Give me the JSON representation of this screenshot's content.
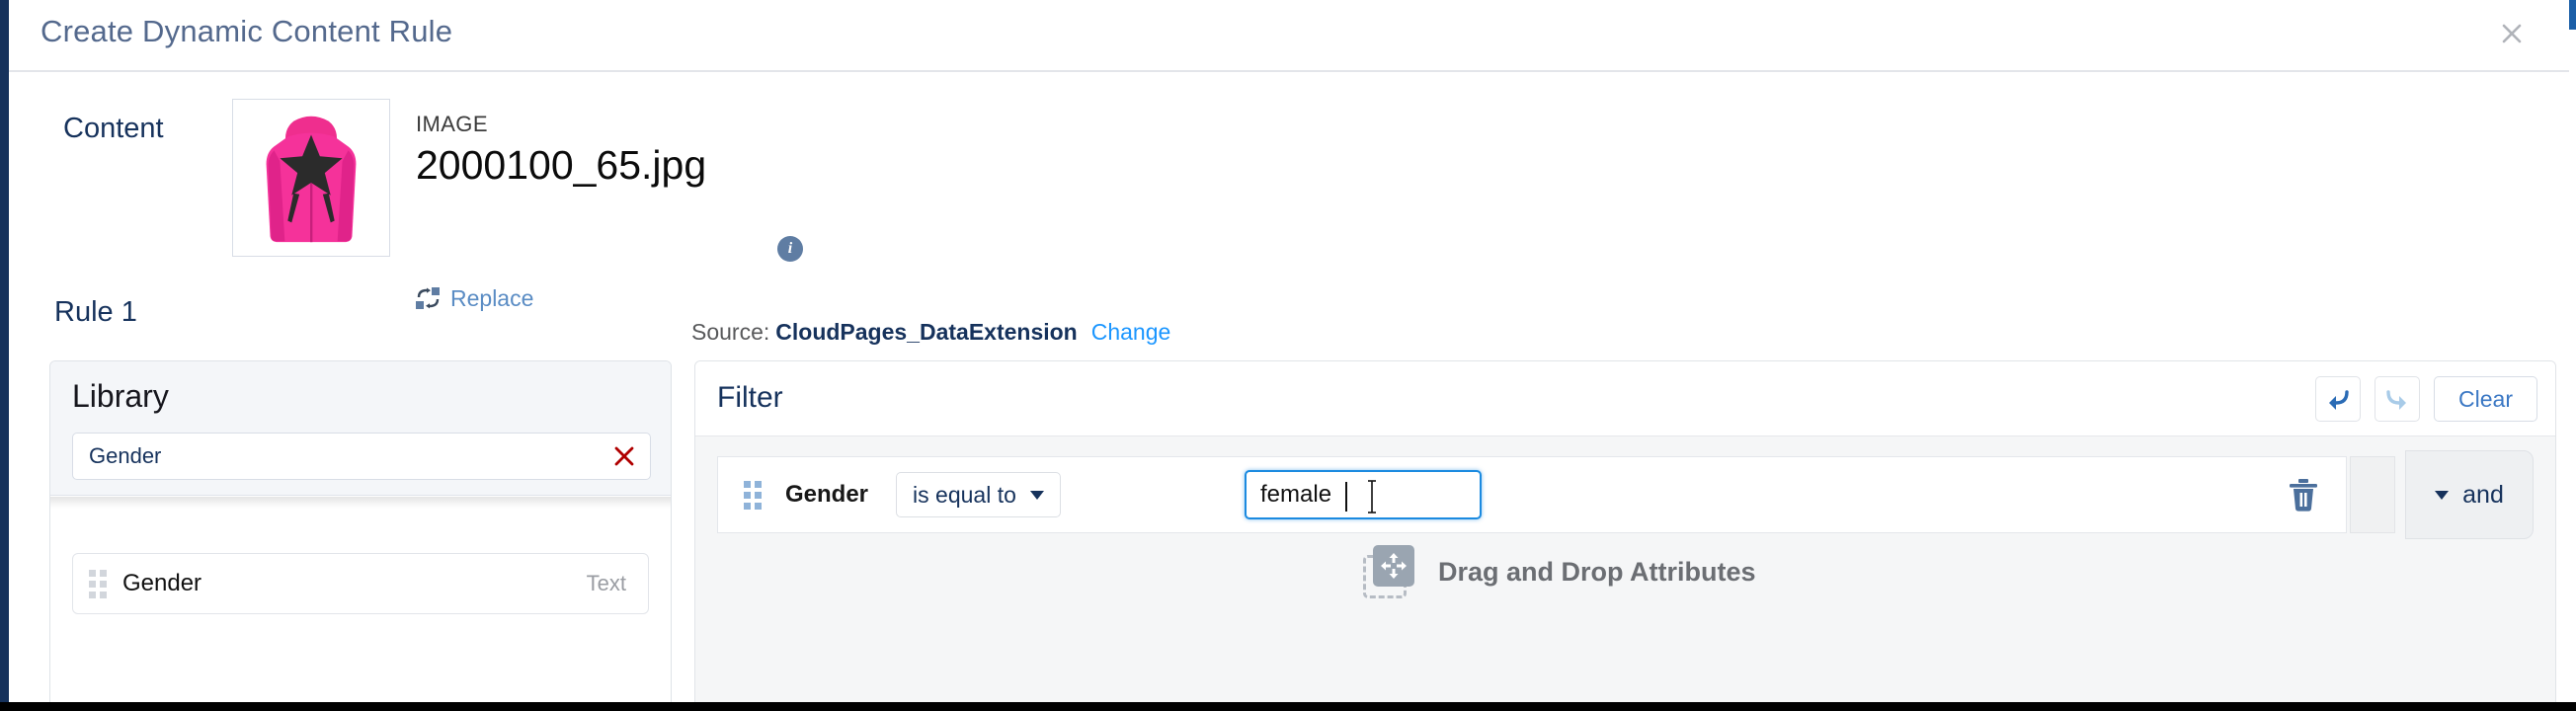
{
  "modal": {
    "title": "Create Dynamic Content Rule",
    "close_icon": "close-icon"
  },
  "content": {
    "label": "Content",
    "asset_kind": "IMAGE",
    "asset_name": "2000100_65.jpg",
    "info_badge": "i",
    "replace_label": "Replace",
    "thumbnail_alt": "pink hooded jacket with black star"
  },
  "rule": {
    "title": "Rule 1"
  },
  "source": {
    "label": "Source:",
    "value": "CloudPages_DataExtension",
    "change_label": "Change"
  },
  "library": {
    "title": "Library",
    "search_value": "Gender",
    "search_placeholder": "Search",
    "clear_icon": "clear-x-icon",
    "attributes": [
      {
        "name": "Gender",
        "type": "Text"
      }
    ]
  },
  "filter": {
    "title": "Filter",
    "undo_icon": "undo-arrow-icon",
    "redo_icon": "redo-arrow-icon",
    "clear_label": "Clear",
    "rows": [
      {
        "field": "Gender",
        "operator": "is equal to",
        "value": "female",
        "delete_icon": "trash-icon"
      }
    ],
    "logic_operator": "and",
    "dropzone_label": "Drag and Drop Attributes"
  },
  "colors": {
    "brand_navy": "#16325c",
    "link_blue": "#1b96ff",
    "focus_blue": "#1b8ae0",
    "clear_red": "#b00000",
    "panel_grey": "#f4f6f9"
  }
}
